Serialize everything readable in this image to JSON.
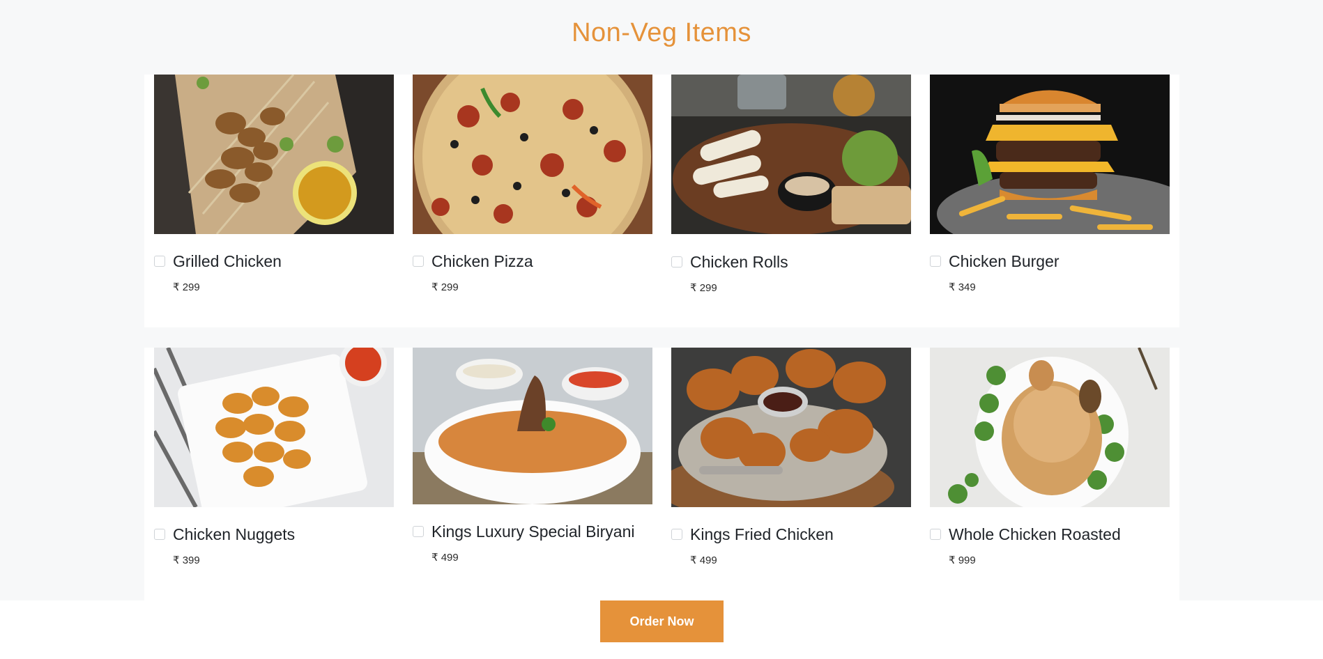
{
  "section": {
    "title": "Non-Veg Items"
  },
  "items": [
    {
      "name": "Grilled Chicken",
      "price": "₹ 299",
      "image": "grilled-chicken-photo"
    },
    {
      "name": "Chicken Pizza",
      "price": "₹ 299",
      "image": "chicken-pizza-photo"
    },
    {
      "name": "Chicken Rolls",
      "price": "₹ 299",
      "image": "chicken-rolls-photo"
    },
    {
      "name": "Chicken Burger",
      "price": "₹ 349",
      "image": "chicken-burger-photo"
    },
    {
      "name": "Chicken Nuggets",
      "price": "₹ 399",
      "image": "chicken-nuggets-photo"
    },
    {
      "name": "Kings Luxury Special Biryani",
      "price": "₹ 499",
      "image": "biryani-photo"
    },
    {
      "name": "Kings Fried Chicken",
      "price": "₹ 499",
      "image": "fried-chicken-photo"
    },
    {
      "name": "Whole Chicken Roasted",
      "price": "₹ 999",
      "image": "roasted-chicken-photo"
    }
  ],
  "actions": {
    "order_label": "Order Now"
  },
  "colors": {
    "accent": "#e5923a",
    "section_bg": "#f7f8f9",
    "card_bg": "#ffffff"
  }
}
